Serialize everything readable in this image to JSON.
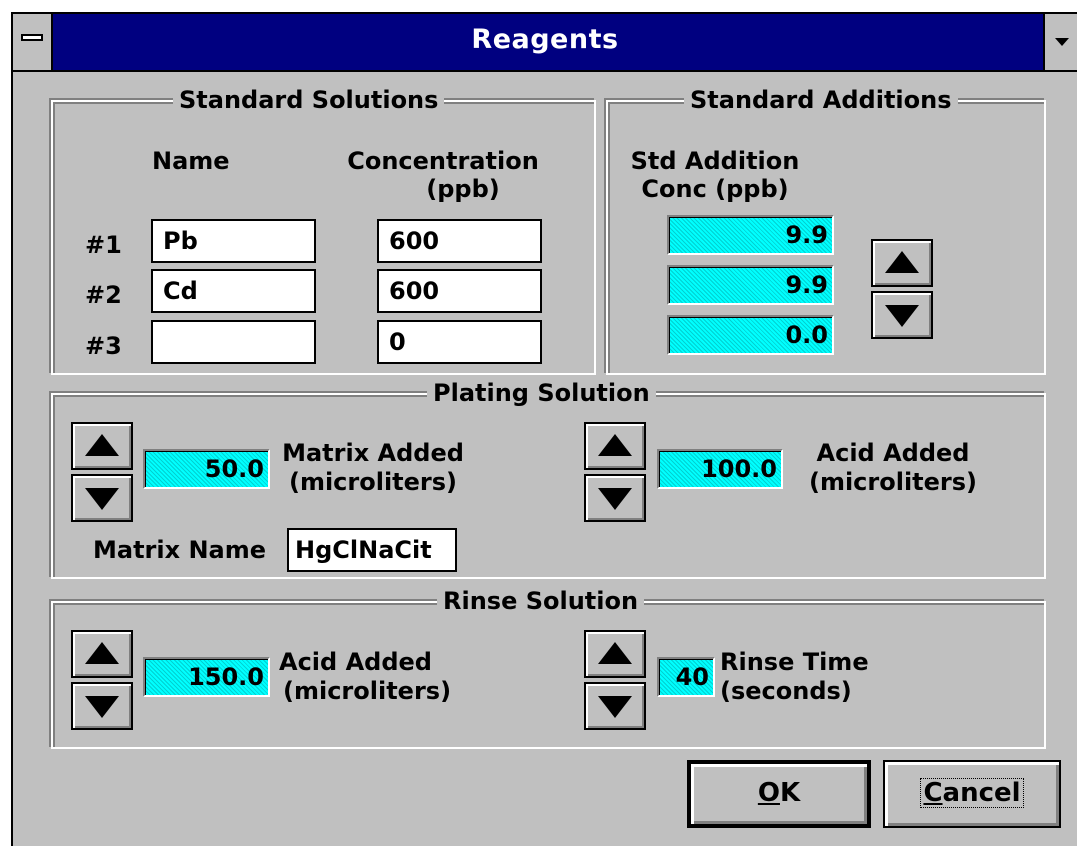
{
  "window": {
    "title": "Reagents"
  },
  "standard_solutions": {
    "legend": "Standard Solutions",
    "col_name": "Name",
    "col_conc_line1": "Concentration",
    "col_conc_line2": "(ppb)",
    "rows": [
      {
        "label": "#1",
        "name": "Pb",
        "conc": "600"
      },
      {
        "label": "#2",
        "name": "Cd",
        "conc": "600"
      },
      {
        "label": "#3",
        "name": "",
        "conc": "0"
      }
    ]
  },
  "standard_additions": {
    "legend": "Standard Additions",
    "header_line1": "Std Addition",
    "header_line2": "Conc (ppb)",
    "values": [
      "9.9",
      "9.9",
      "0.0"
    ]
  },
  "plating_solution": {
    "legend": "Plating Solution",
    "matrix_value": "50.0",
    "matrix_label_line1": "Matrix Added",
    "matrix_label_line2": "(microliters)",
    "acid_value": "100.0",
    "acid_label_line1": "Acid Added",
    "acid_label_line2": "(microliters)",
    "matrix_name_label": "Matrix Name",
    "matrix_name": "HgClNaCit"
  },
  "rinse_solution": {
    "legend": "Rinse Solution",
    "acid_value": "150.0",
    "acid_label_line1": "Acid Added",
    "acid_label_line2": "(microliters)",
    "time_value": "40",
    "time_label_line1": "Rinse Time",
    "time_label_line2": "(seconds)"
  },
  "buttons": {
    "ok_mnemonic": "O",
    "ok_rest": "K",
    "cancel_mnemonic": "C",
    "cancel_rest": "ancel"
  },
  "colors": {
    "title_bar": "#000080",
    "dialog_face": "#c0c0c0",
    "value_fill": "#00ffff"
  },
  "icons": {
    "system_menu": "system-menu-bar-icon",
    "minimize": "triangle-down-icon",
    "spin_up": "triangle-up-icon",
    "spin_down": "triangle-down-icon"
  }
}
